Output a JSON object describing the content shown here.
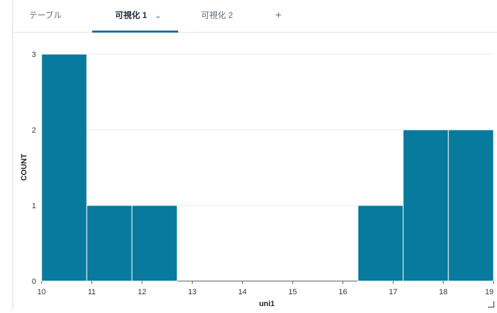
{
  "tabs": [
    {
      "label": "テーブル",
      "active": false
    },
    {
      "label": "可視化 1",
      "active": true
    },
    {
      "label": "可視化 2",
      "active": false
    }
  ],
  "add_tab_icon": "plus-icon",
  "active_tab_dropdown_icon": "chevron-down-icon",
  "colors": {
    "bar": "#077a9d",
    "accent": "#1b6fa3",
    "grid": "#e8e8e8"
  },
  "chart_data": {
    "type": "bar",
    "xlabel": "uni1",
    "ylabel": "COUNT",
    "xlim": [
      10,
      19
    ],
    "ylim": [
      0,
      3
    ],
    "xticks": [
      "10",
      "11",
      "12",
      "13",
      "14",
      "15",
      "16",
      "17",
      "18",
      "19"
    ],
    "yticks": [
      "0",
      "1",
      "2",
      "3"
    ],
    "bins": [
      {
        "x0": 10,
        "x1": 10.9,
        "count": 3
      },
      {
        "x0": 10.9,
        "x1": 11.8,
        "count": 1
      },
      {
        "x0": 11.8,
        "x1": 12.7,
        "count": 1
      },
      {
        "x0": 12.7,
        "x1": 13.6,
        "count": 0
      },
      {
        "x0": 13.6,
        "x1": 14.5,
        "count": 0
      },
      {
        "x0": 14.5,
        "x1": 15.4,
        "count": 0
      },
      {
        "x0": 15.4,
        "x1": 16.3,
        "count": 0
      },
      {
        "x0": 16.3,
        "x1": 17.2,
        "count": 1
      },
      {
        "x0": 17.2,
        "x1": 18.1,
        "count": 2
      },
      {
        "x0": 18.1,
        "x1": 19,
        "count": 2
      }
    ],
    "grid": true
  }
}
